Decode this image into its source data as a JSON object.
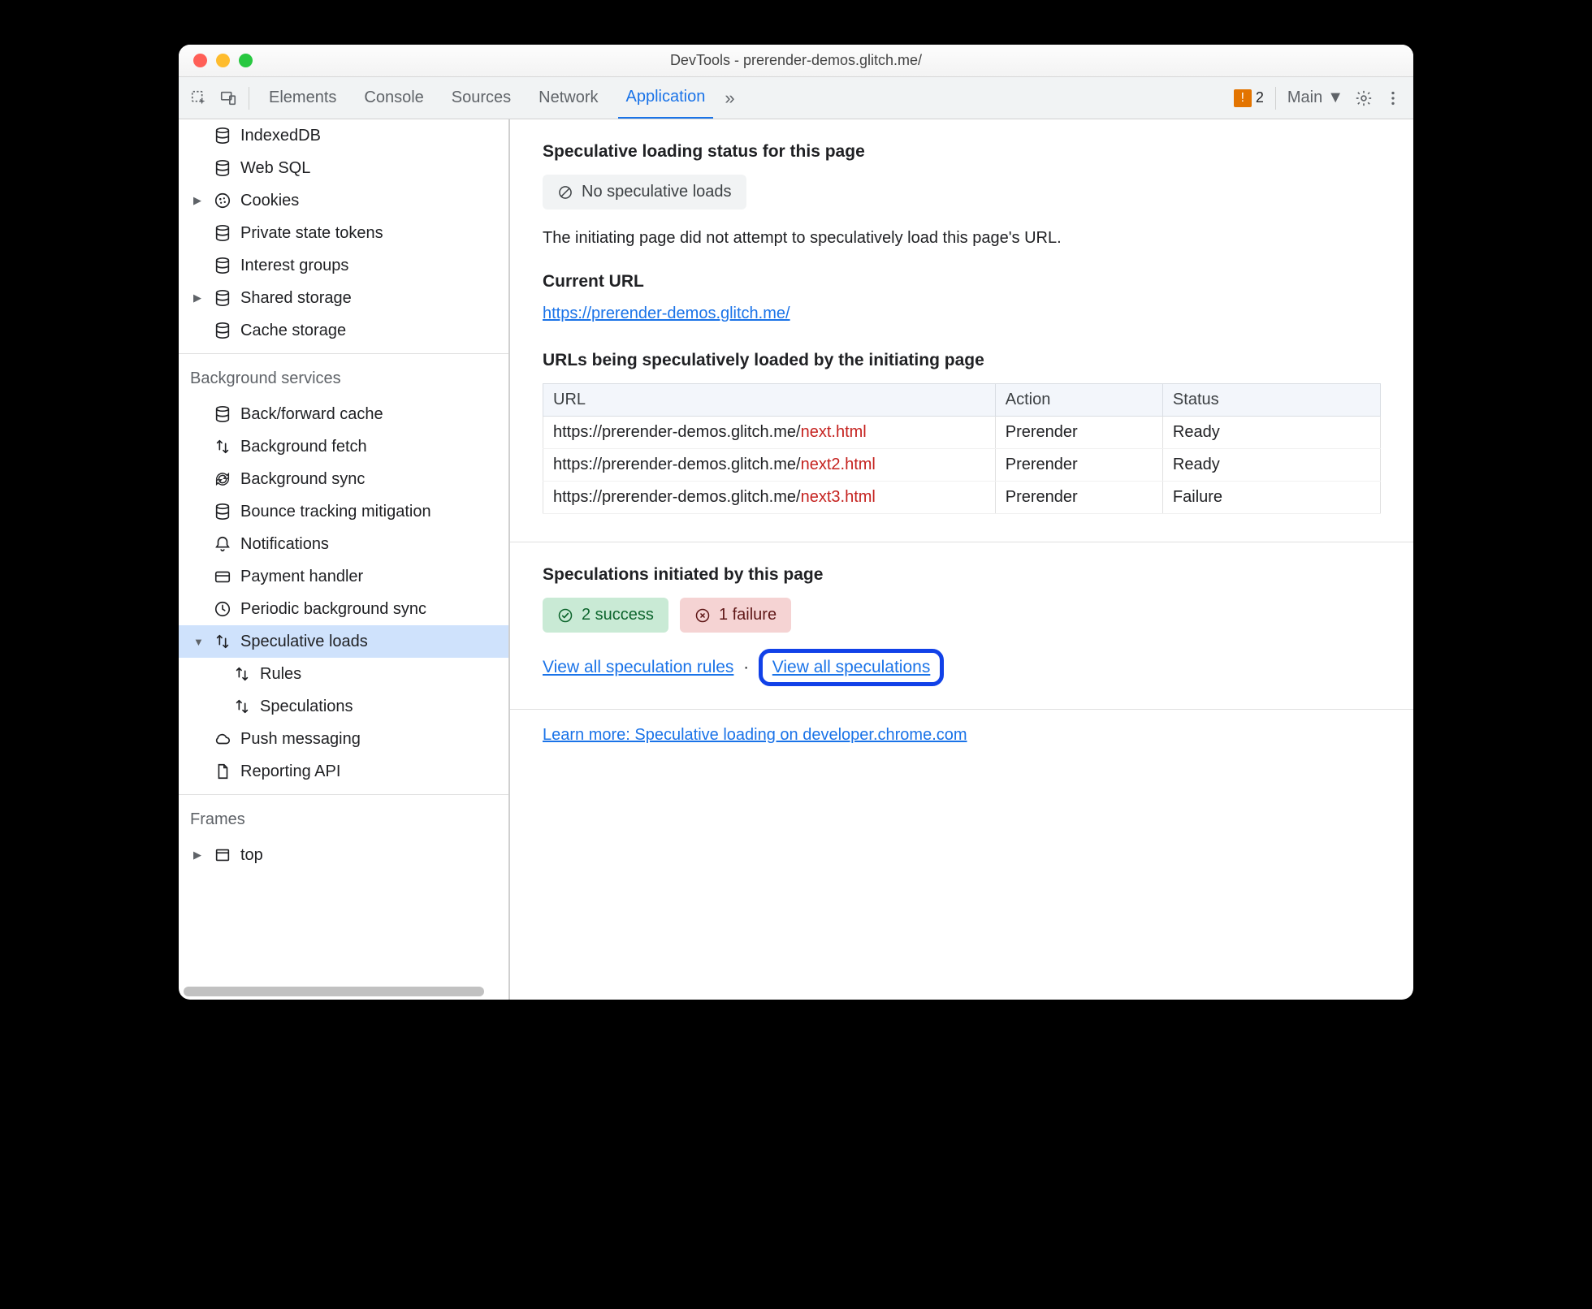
{
  "window": {
    "title": "DevTools - prerender-demos.glitch.me/"
  },
  "toolbar": {
    "tabs": [
      "Elements",
      "Console",
      "Sources",
      "Network",
      "Application"
    ],
    "active_tab": "Application",
    "warning_count": "2",
    "context_label": "Main"
  },
  "sidebar": {
    "storage_items": [
      {
        "label": "IndexedDB",
        "icon": "db"
      },
      {
        "label": "Web SQL",
        "icon": "db"
      },
      {
        "label": "Cookies",
        "icon": "cookie",
        "expandable": true
      },
      {
        "label": "Private state tokens",
        "icon": "db"
      },
      {
        "label": "Interest groups",
        "icon": "db"
      },
      {
        "label": "Shared storage",
        "icon": "db",
        "expandable": true
      },
      {
        "label": "Cache storage",
        "icon": "db"
      }
    ],
    "bg_header": "Background services",
    "bg_items": [
      {
        "label": "Back/forward cache",
        "icon": "db"
      },
      {
        "label": "Background fetch",
        "icon": "updown"
      },
      {
        "label": "Background sync",
        "icon": "sync"
      },
      {
        "label": "Bounce tracking mitigation",
        "icon": "db"
      },
      {
        "label": "Notifications",
        "icon": "bell"
      },
      {
        "label": "Payment handler",
        "icon": "card"
      },
      {
        "label": "Periodic background sync",
        "icon": "clock"
      },
      {
        "label": "Speculative loads",
        "icon": "updown",
        "selected": true,
        "expandable": true,
        "expanded": true,
        "children": [
          {
            "label": "Rules",
            "icon": "updown"
          },
          {
            "label": "Speculations",
            "icon": "updown"
          }
        ]
      },
      {
        "label": "Push messaging",
        "icon": "cloud"
      },
      {
        "label": "Reporting API",
        "icon": "doc"
      }
    ],
    "frames_header": "Frames",
    "frames": [
      {
        "label": "top",
        "icon": "window",
        "expandable": true
      }
    ]
  },
  "content": {
    "status_heading": "Speculative loading status for this page",
    "status_chip": "No speculative loads",
    "status_desc": "The initiating page did not attempt to speculatively load this page's URL.",
    "current_url_heading": "Current URL",
    "current_url": "https://prerender-demos.glitch.me/",
    "table_heading": "URLs being speculatively loaded by the initiating page",
    "table": {
      "headers": [
        "URL",
        "Action",
        "Status"
      ],
      "rows": [
        {
          "url_prefix": "https://prerender-demos.glitch.me/",
          "url_suffix": "next.html",
          "action": "Prerender",
          "status": "Ready"
        },
        {
          "url_prefix": "https://prerender-demos.glitch.me/",
          "url_suffix": "next2.html",
          "action": "Prerender",
          "status": "Ready"
        },
        {
          "url_prefix": "https://prerender-demos.glitch.me/",
          "url_suffix": "next3.html",
          "action": "Prerender",
          "status": "Failure"
        }
      ]
    },
    "spec_heading": "Speculations initiated by this page",
    "success_chip": "2 success",
    "failure_chip": "1 failure",
    "link_rules": "View all speculation rules",
    "link_specs": "View all speculations",
    "learn_more": "Learn more: Speculative loading on developer.chrome.com"
  }
}
